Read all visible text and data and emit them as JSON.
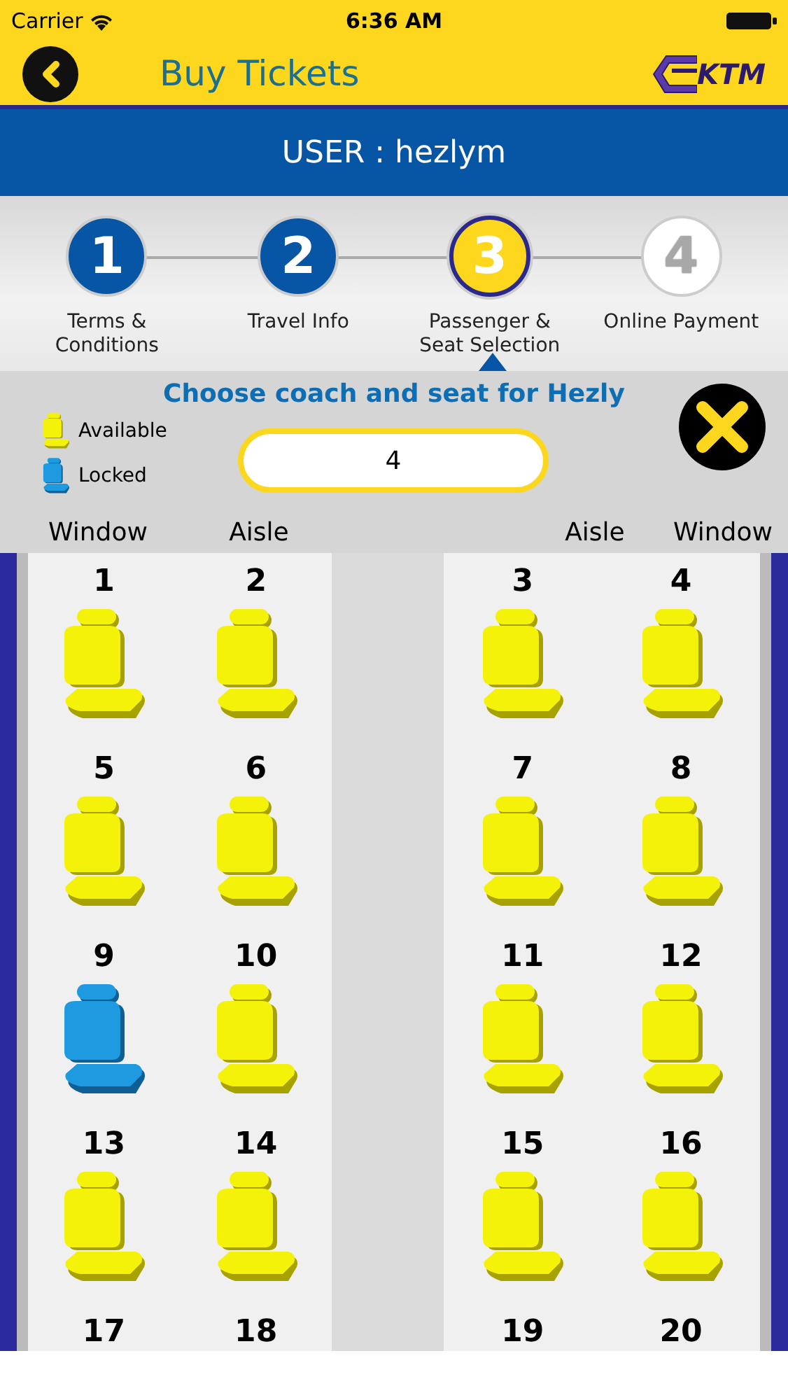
{
  "status_bar": {
    "carrier": "Carrier",
    "time": "6:36 AM"
  },
  "nav": {
    "title": "Buy Tickets",
    "logo": "KTM"
  },
  "user_banner": "USER : hezlym",
  "steps": [
    {
      "number": "1",
      "label": "Terms &\nConditions",
      "completed": true,
      "selected": false
    },
    {
      "number": "2",
      "label": "Travel Info",
      "completed": true,
      "selected": false
    },
    {
      "number": "3",
      "label": "Passenger &\nSeat Selection",
      "completed": false,
      "selected": true
    },
    {
      "number": "4",
      "label": "Online Payment",
      "completed": false,
      "selected": false
    }
  ],
  "panel": {
    "title": "Choose coach and seat for Hezly",
    "legend": [
      {
        "label": "Available",
        "locked": false
      },
      {
        "label": "Locked",
        "locked": true
      }
    ],
    "coach_field": "4"
  },
  "column_headers": [
    "Window",
    "Aisle",
    "Aisle",
    "Window"
  ],
  "seat_rows": [
    [
      {
        "number": "1",
        "locked": false
      },
      {
        "number": "2",
        "locked": false
      },
      {
        "number": "3",
        "locked": false
      },
      {
        "number": "4",
        "locked": false
      }
    ],
    [
      {
        "number": "5",
        "locked": false
      },
      {
        "number": "6",
        "locked": false
      },
      {
        "number": "7",
        "locked": false
      },
      {
        "number": "8",
        "locked": false
      }
    ],
    [
      {
        "number": "9",
        "locked": true
      },
      {
        "number": "10",
        "locked": false
      },
      {
        "number": "11",
        "locked": false
      },
      {
        "number": "12",
        "locked": false
      }
    ],
    [
      {
        "number": "13",
        "locked": false
      },
      {
        "number": "14",
        "locked": false
      },
      {
        "number": "15",
        "locked": false
      },
      {
        "number": "16",
        "locked": false
      }
    ],
    [
      {
        "number": "17"
      },
      {
        "number": "18"
      },
      {
        "number": "19"
      },
      {
        "number": "20"
      }
    ]
  ]
}
